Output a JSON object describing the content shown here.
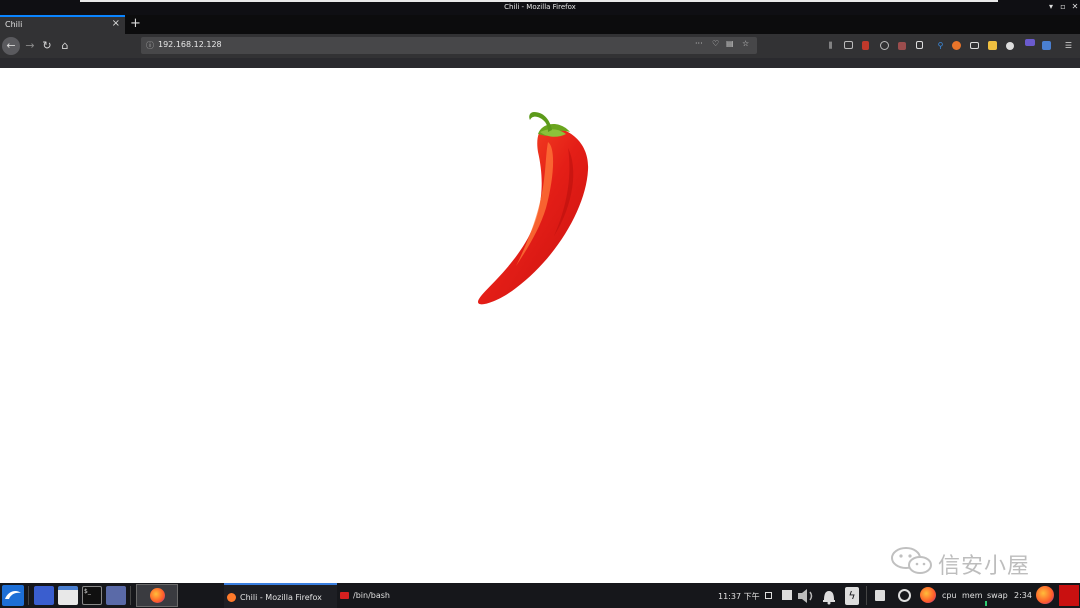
{
  "window": {
    "title": "Chili - Mozilla Firefox",
    "minimize": "▾",
    "maximize": "▫",
    "close": "✕"
  },
  "tabs": [
    {
      "label": "Chili",
      "close": "×"
    }
  ],
  "new_tab": "+",
  "navbar": {
    "back": "←",
    "forward": "→",
    "reload": "↻",
    "home": "⌂",
    "url": "192.168.12.128",
    "info": "ⓘ",
    "page_actions": "···",
    "pocket": "♡",
    "reader": "▤",
    "bookmark_star": "☆",
    "menu": "☰"
  },
  "watermark": {
    "text": "信安小屋"
  },
  "taskbar": {
    "tasks": [
      {
        "label": "Chili - Mozilla Firefox"
      },
      {
        "label": "/bin/bash"
      }
    ],
    "clock": "11:37 下午",
    "cpu": "cpu",
    "mem": "mem",
    "swap": "swap",
    "time": "2:34",
    "terminal_glyph": "$_"
  },
  "colors": {
    "accent": "#0a84ff",
    "pepper_red": "#e0201a",
    "stem_green": "#6aa51e"
  }
}
